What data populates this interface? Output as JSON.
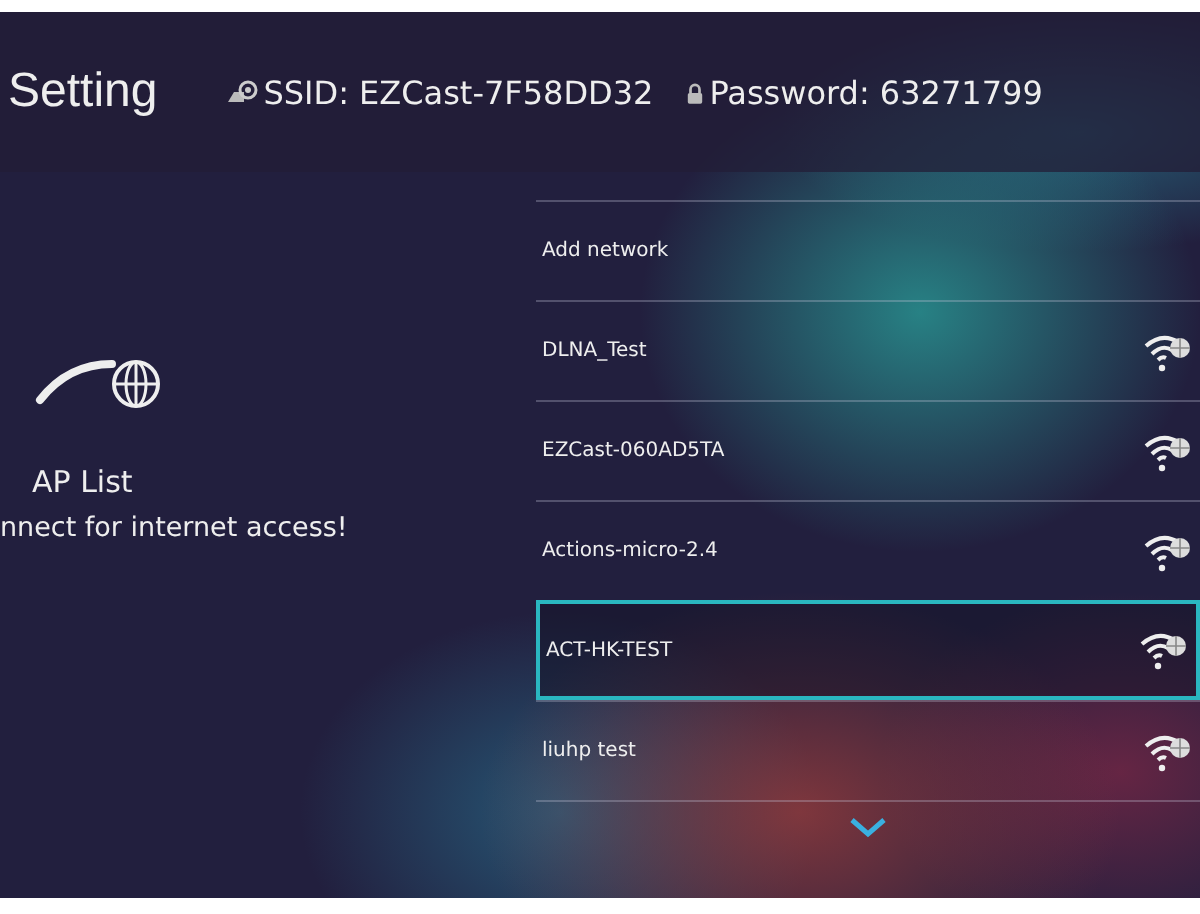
{
  "header": {
    "title": "Setting",
    "ssid": "SSID: EZCast-7F58DD32",
    "password": "Password: 63271799"
  },
  "left_panel": {
    "title": "AP List",
    "caption": "nnect for internet access!"
  },
  "networks": [
    {
      "kind": "add",
      "name": "Add network",
      "selected": false
    },
    {
      "kind": "network",
      "name": "DLNA_Test",
      "selected": false
    },
    {
      "kind": "network",
      "name": "EZCast-060AD5TA",
      "selected": false
    },
    {
      "kind": "network",
      "name": "Actions-micro-2.4",
      "selected": false
    },
    {
      "kind": "network",
      "name": "ACT-HK-TEST",
      "selected": true
    },
    {
      "kind": "network",
      "name": "liuhp test",
      "selected": false
    }
  ]
}
